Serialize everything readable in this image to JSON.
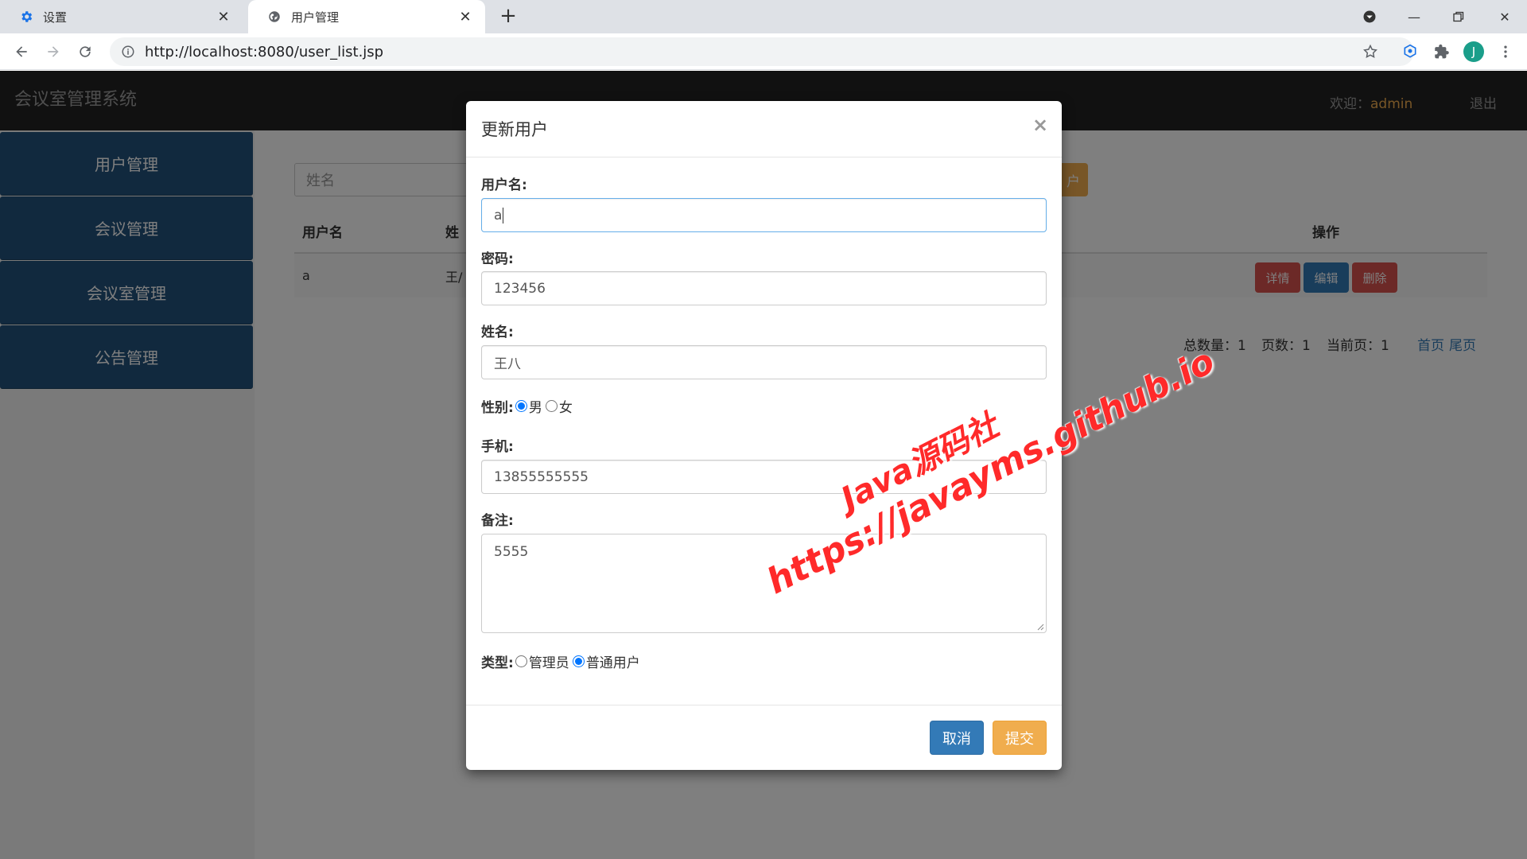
{
  "browser": {
    "tabs": [
      {
        "label": "设置",
        "icon": "gear-icon",
        "active": false
      },
      {
        "label": "用户管理",
        "icon": "globe-icon",
        "active": true
      }
    ],
    "url": "http://localhost:8080/user_list.jsp",
    "profile_initial": "J"
  },
  "header": {
    "app_title": "会议室管理系统",
    "welcome_label": "欢迎：",
    "username": "admin",
    "logout_label": "退出"
  },
  "sidebar": {
    "items": [
      {
        "label": "用户管理"
      },
      {
        "label": "会议管理"
      },
      {
        "label": "会议室管理"
      },
      {
        "label": "公告管理"
      }
    ]
  },
  "main": {
    "search_placeholder": "姓名",
    "add_button_partial": "户",
    "table": {
      "columns": [
        "用户名",
        "姓",
        "操作"
      ],
      "rows": [
        {
          "username": "a",
          "name_partial": "王/"
        }
      ],
      "actions": [
        "详情",
        "编辑",
        "删除"
      ]
    },
    "pagination": {
      "total_label": "总数量：",
      "total": "1",
      "pages_label": "页数：",
      "pages": "1",
      "current_label": "当前页：",
      "current": "1",
      "first_label": "首页",
      "last_label": "尾页"
    }
  },
  "modal": {
    "title": "更新用户",
    "close_glyph": "×",
    "fields": {
      "username_label": "用户名:",
      "username_value": "a",
      "password_label": "密码:",
      "password_value": "123456",
      "name_label": "姓名:",
      "name_value": "王八",
      "gender_label": "性别:",
      "gender_options": [
        "男",
        "女"
      ],
      "gender_selected": "男",
      "phone_label": "手机:",
      "phone_value": "13855555555",
      "remark_label": "备注:",
      "remark_value": "5555",
      "type_label": "类型:",
      "type_options": [
        "管理员",
        "普通用户"
      ],
      "type_selected": "普通用户"
    },
    "cancel_label": "取消",
    "submit_label": "提交"
  },
  "colors": {
    "primary": "#337ab7",
    "warning": "#f0ad4e",
    "danger": "#d9534f",
    "header_bg": "#222222",
    "sidebar_item": "#23527c",
    "watermark": "#ff2a2a"
  },
  "watermark": {
    "line1": "Java源码社",
    "line2": "https://javayms.github.io"
  }
}
